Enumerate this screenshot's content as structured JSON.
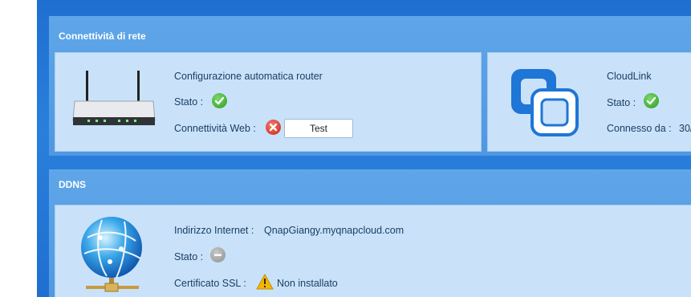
{
  "network": {
    "section_title": "Connettività di rete",
    "router": {
      "title": "Configurazione automatica router",
      "status_label": "Stato :",
      "web_label": "Connettività Web :",
      "test_button": "Test"
    },
    "cloudlink": {
      "title": "CloudLink",
      "status_label": "Stato :",
      "connected_label": "Connesso da :",
      "connected_value": "30/"
    }
  },
  "ddns": {
    "section_title": "DDNS",
    "internet_label": "Indirizzo Internet :",
    "internet_value": "QnapGiangy.myqnapcloud.com",
    "status_label": "Stato :",
    "ssl_label": "Certificato SSL :",
    "ssl_value": "Non installato"
  },
  "colors": {
    "ok": "#2b9b22",
    "error": "#c9261a",
    "warning": "#f2b705",
    "disabled": "#8e8e8e"
  },
  "icons": [
    "router-icon",
    "cloudlink-icon",
    "globe-network-icon",
    "check-icon",
    "error-x-icon",
    "disabled-icon",
    "warning-icon"
  ]
}
